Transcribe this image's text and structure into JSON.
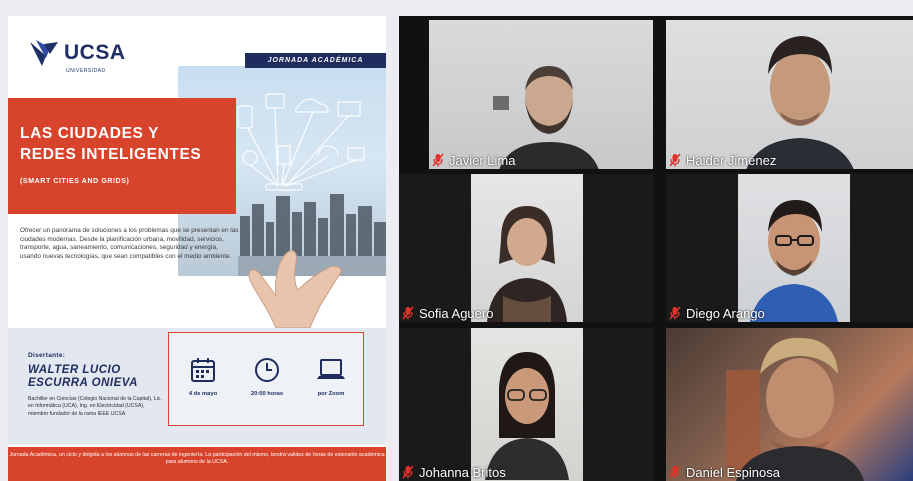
{
  "poster": {
    "logo": {
      "text": "UCSA",
      "sub": "UNIVERSIDAD"
    },
    "banner": "JORNADA ACADÉMICA",
    "title_line1": "LAS CIUDADES Y",
    "title_line2": "REDES INTELIGENTES",
    "subtitle": "(SMART CITIES AND GRIDS)",
    "description": "Ofrecer un panorama de soluciones a los problemas que se presentan en las ciudades modernas. Desde la planificación urbana, movilidad, servicios, transporte, agua, saneamiento, comunicaciones, seguridad y energía, usando nuevas tecnologías, que sean compatibles con el medio ambiente.",
    "disertante_label": "Disertante:",
    "speaker_line1": "WALTER LUCIO",
    "speaker_line2": "ESCURRA ONIEVA",
    "speaker_bio": "Bachiller en Ciencias (Colegio Nacional de la Capital), Lic. en Informática (UCA), Ing. en Electricidad (UCSA), miembro fundador de la rama IEEE UCSA.",
    "event": {
      "date": "4 de mayo",
      "time": "20:00 horas",
      "platform": "por Zoom"
    },
    "footer": "Jornada Académica, un ciclo y dirigida a los alumnos de las carreras de ingeniería. La participación del mismo, tendrá validez de horas de extensión académica para alumnos de la UCSA."
  },
  "participants": [
    {
      "name": "Javier Lima",
      "icon": "mic-muted-icon"
    },
    {
      "name": "Haider Jiménez",
      "icon": "mic-muted-icon"
    },
    {
      "name": "Sofia Aguero",
      "icon": "mic-muted-icon"
    },
    {
      "name": "Diego Arango",
      "icon": "mic-muted-icon"
    },
    {
      "name": "Johanna Britos",
      "icon": "mic-muted-icon"
    },
    {
      "name": "Daniel Espinosa",
      "icon": "mic-muted-icon"
    }
  ],
  "colors": {
    "accent_red": "#d8432c",
    "navy": "#1e2c5e",
    "mic_muted": "#e0322b"
  }
}
